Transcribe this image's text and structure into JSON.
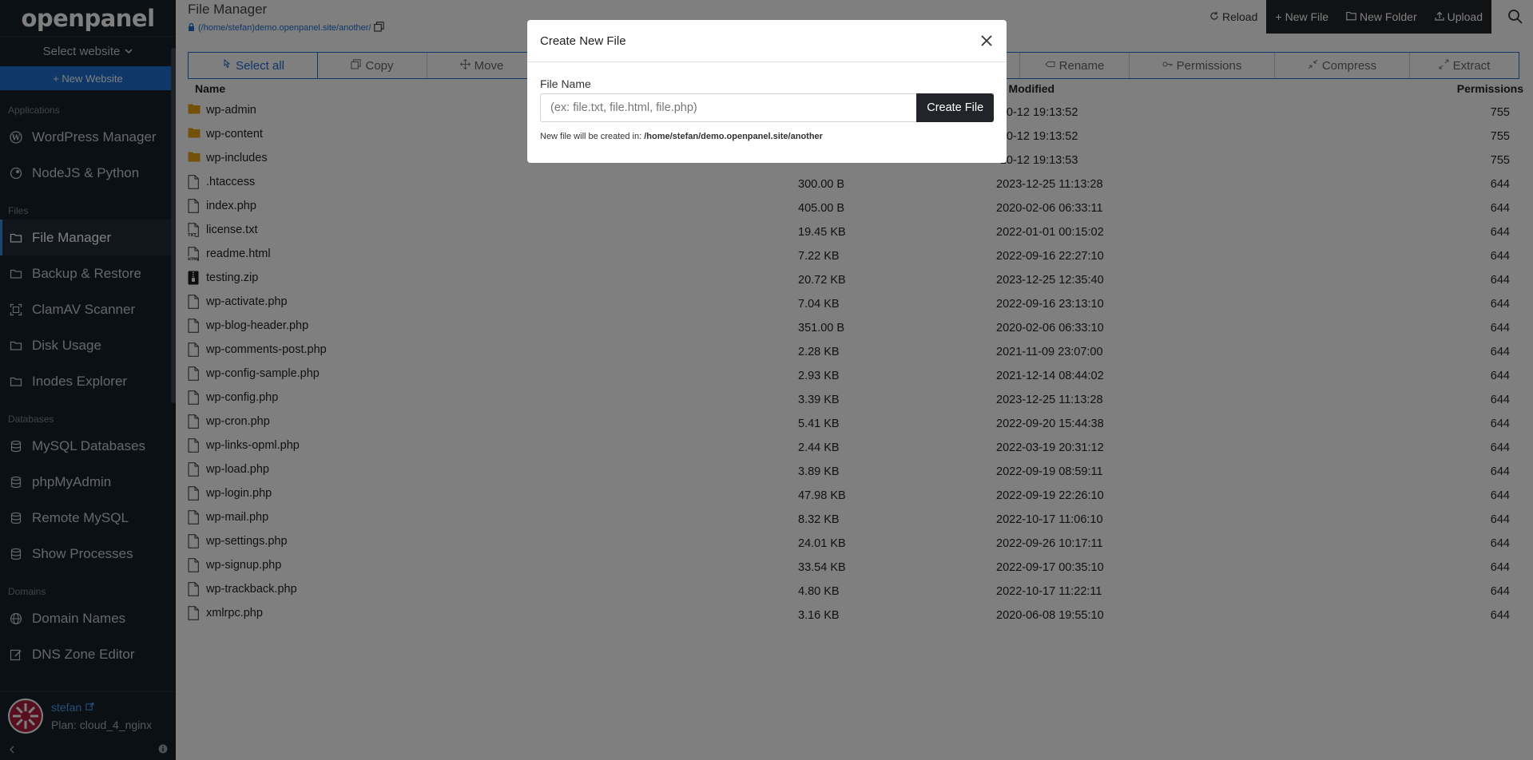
{
  "brand": "openpanel",
  "sidebar": {
    "select_website": "Select website",
    "new_website": "+ New Website",
    "sections": {
      "applications": "Applications",
      "files": "Files",
      "databases": "Databases",
      "domains": "Domains"
    },
    "items": {
      "wordpress": "WordPress Manager",
      "nodejs": "NodeJS & Python",
      "file_manager": "File Manager",
      "backup": "Backup & Restore",
      "clamav": "ClamAV Scanner",
      "disk": "Disk Usage",
      "inodes": "Inodes Explorer",
      "mysql": "MySQL Databases",
      "phpmyadmin": "phpMyAdmin",
      "remote_mysql": "Remote MySQL",
      "processes": "Show Processes",
      "domain_names": "Domain Names",
      "dns": "DNS Zone Editor"
    },
    "user": {
      "name": "stefan",
      "plan": "Plan: cloud_4_nginx"
    }
  },
  "header": {
    "title": "File Manager",
    "path": "(/home/stefan)demo.openpanel.site/another/",
    "actions": {
      "reload": "Reload",
      "new_file": "New File",
      "new_folder": "New Folder",
      "upload": "Upload"
    }
  },
  "toolbar": {
    "select_all": "Select all",
    "copy": "Copy",
    "move": "Move",
    "rename": "Rename",
    "permissions": "Permissions",
    "compress": "Compress",
    "extract": "Extract"
  },
  "table": {
    "headers": {
      "name": "Name",
      "modified": "t Modified",
      "permissions": "Permissions"
    },
    "rows": [
      {
        "name": "wp-admin",
        "type": "folder",
        "size": "",
        "modified": "-10-12 19:13:52",
        "perm": "755"
      },
      {
        "name": "wp-content",
        "type": "folder",
        "size": "",
        "modified": "-10-12 19:13:52",
        "perm": "755"
      },
      {
        "name": "wp-includes",
        "type": "folder",
        "size": "",
        "modified": "-10-12 19:13:53",
        "perm": "755"
      },
      {
        "name": ".htaccess",
        "type": "file",
        "size": "300.00 B",
        "modified": "2023-12-25 11:13:28",
        "perm": "644"
      },
      {
        "name": "index.php",
        "type": "file",
        "size": "405.00 B",
        "modified": "2020-02-06 06:33:11",
        "perm": "644"
      },
      {
        "name": "license.txt",
        "type": "txt",
        "size": "19.45 KB",
        "modified": "2022-01-01 00:15:02",
        "perm": "644"
      },
      {
        "name": "readme.html",
        "type": "html",
        "size": "7.22 KB",
        "modified": "2022-09-16 22:27:10",
        "perm": "644"
      },
      {
        "name": "testing.zip",
        "type": "zip",
        "size": "20.72 KB",
        "modified": "2023-12-25 12:35:40",
        "perm": "644"
      },
      {
        "name": "wp-activate.php",
        "type": "file",
        "size": "7.04 KB",
        "modified": "2022-09-16 23:13:10",
        "perm": "644"
      },
      {
        "name": "wp-blog-header.php",
        "type": "file",
        "size": "351.00 B",
        "modified": "2020-02-06 06:33:10",
        "perm": "644"
      },
      {
        "name": "wp-comments-post.php",
        "type": "file",
        "size": "2.28 KB",
        "modified": "2021-11-09 23:07:00",
        "perm": "644"
      },
      {
        "name": "wp-config-sample.php",
        "type": "file",
        "size": "2.93 KB",
        "modified": "2021-12-14 08:44:02",
        "perm": "644"
      },
      {
        "name": "wp-config.php",
        "type": "file",
        "size": "3.39 KB",
        "modified": "2023-12-25 11:13:28",
        "perm": "644"
      },
      {
        "name": "wp-cron.php",
        "type": "file",
        "size": "5.41 KB",
        "modified": "2022-09-20 15:44:38",
        "perm": "644"
      },
      {
        "name": "wp-links-opml.php",
        "type": "file",
        "size": "2.44 KB",
        "modified": "2022-03-19 20:31:12",
        "perm": "644"
      },
      {
        "name": "wp-load.php",
        "type": "file",
        "size": "3.89 KB",
        "modified": "2022-09-19 08:59:11",
        "perm": "644"
      },
      {
        "name": "wp-login.php",
        "type": "file",
        "size": "47.98 KB",
        "modified": "2022-09-19 22:26:10",
        "perm": "644"
      },
      {
        "name": "wp-mail.php",
        "type": "file",
        "size": "8.32 KB",
        "modified": "2022-10-17 11:06:10",
        "perm": "644"
      },
      {
        "name": "wp-settings.php",
        "type": "file",
        "size": "24.01 KB",
        "modified": "2022-09-26 10:17:11",
        "perm": "644"
      },
      {
        "name": "wp-signup.php",
        "type": "file",
        "size": "33.54 KB",
        "modified": "2022-09-17 00:35:10",
        "perm": "644"
      },
      {
        "name": "wp-trackback.php",
        "type": "file",
        "size": "4.80 KB",
        "modified": "2022-10-17 11:22:11",
        "perm": "644"
      },
      {
        "name": "xmlrpc.php",
        "type": "file",
        "size": "3.16 KB",
        "modified": "2020-06-08 19:55:10",
        "perm": "644"
      }
    ]
  },
  "modal": {
    "title": "Create New File",
    "label": "File Name",
    "placeholder": "(ex: file.txt, file.html, file.php)",
    "value": "",
    "button": "Create File",
    "hint_prefix": "New file will be created in:",
    "hint_path": "/home/stefan/demo.openpanel.site/another"
  },
  "colors": {
    "accent": "#1f6fd1",
    "sidebar_bg": "#17202a",
    "folder": "#e8a317",
    "dark_button": "#212529",
    "overlay": "rgba(0,0,0,0.5)"
  },
  "icons": {
    "folder": "folder-icon",
    "file": "file-icon",
    "txt": "txt-file-icon",
    "html": "html-file-icon",
    "zip": "zip-file-icon"
  }
}
